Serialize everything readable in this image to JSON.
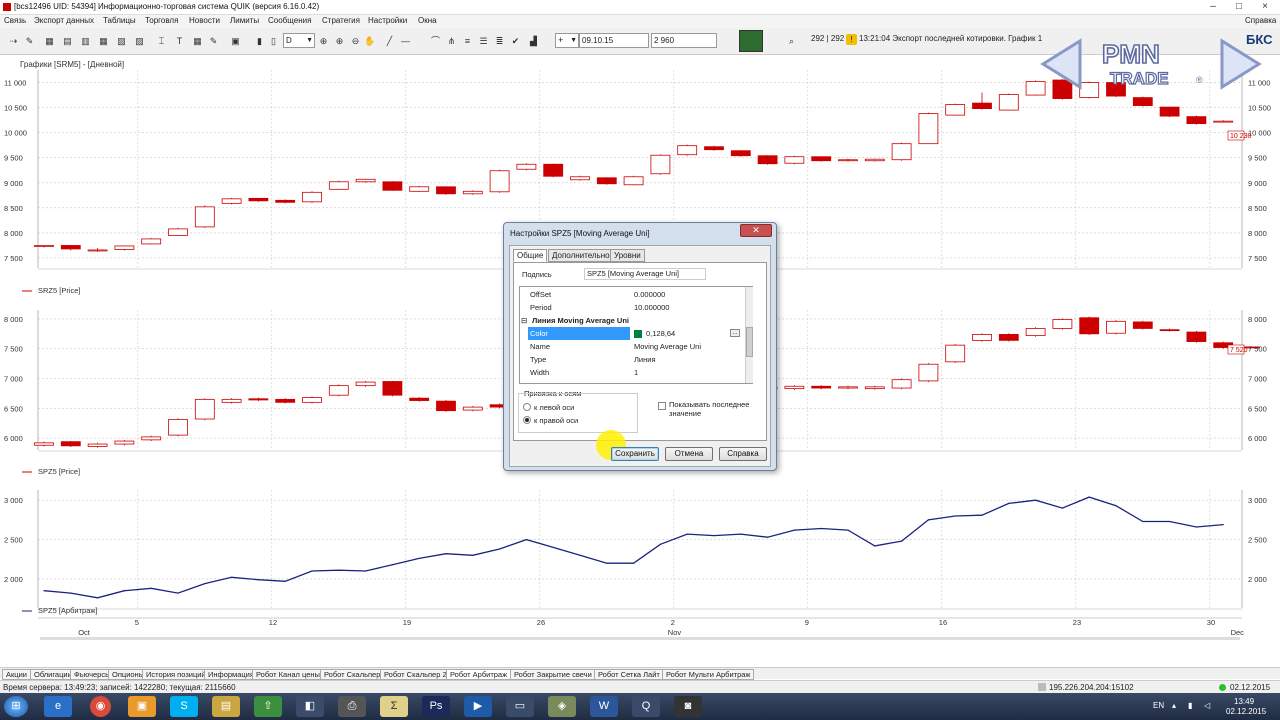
{
  "window": {
    "title": "[bcs12496 UID: 54394] Информационно-торговая система QUIK (версия 6.16.0.42)",
    "controls": [
      "–",
      "□",
      "×"
    ]
  },
  "menu": {
    "items": [
      "Связь",
      "Экспорт данных",
      "Таблицы",
      "Торговля",
      "Новости",
      "Лимиты",
      "Сообщения",
      "Стратегия",
      "Настройки",
      "Окна"
    ],
    "help": "Справка"
  },
  "toolbar": {
    "period": "D",
    "date_field": "09.10.15",
    "price_field": "2 960",
    "trade_counter": "292 | 292",
    "alert_text": "13:21:04  Экспорт последней котировки. График 1 М1 недосту",
    "broker_tag": "БКС"
  },
  "logo": {
    "line1": "PMN",
    "line2": "TRADE",
    "registered": "®"
  },
  "chart": {
    "window_title": "Графики [SRM5] - [Дневной]",
    "panel1_label": "SRZ5 [Price]",
    "panel2_label": "SPZ5 [Price]",
    "panel3_label": "SPZ5 [Арбитраж]",
    "panel1_last": "10 230",
    "panel2_last": "7 520"
  },
  "chart_data": [
    {
      "type": "candlestick",
      "series": [
        {
          "name": "SRZ5 [Price]"
        }
      ],
      "y_ticks": [
        7500,
        8000,
        8500,
        9000,
        9500,
        10000,
        10500,
        11000
      ],
      "y_tick_labels": [
        "7 500",
        "8 000",
        "8 500",
        "9 000",
        "9 500",
        "10 000",
        "10 500",
        "11 000"
      ],
      "ylim": [
        7300,
        11250
      ],
      "last_value": 10230,
      "candles": [
        [
          7730,
          7750,
          7710,
          7760
        ],
        [
          7750,
          7680,
          7650,
          7760
        ],
        [
          7640,
          7660,
          7620,
          7700
        ],
        [
          7670,
          7740,
          7650,
          7750
        ],
        [
          7780,
          7880,
          7770,
          7900
        ],
        [
          7950,
          8080,
          7940,
          8100
        ],
        [
          8120,
          8520,
          8100,
          8550
        ],
        [
          8590,
          8680,
          8570,
          8700
        ],
        [
          8690,
          8640,
          8620,
          8700
        ],
        [
          8650,
          8610,
          8590,
          8670
        ],
        [
          8620,
          8810,
          8600,
          8830
        ],
        [
          8870,
          9020,
          8860,
          9040
        ],
        [
          9020,
          9070,
          9000,
          9080
        ],
        [
          9020,
          8850,
          8840,
          9030
        ],
        [
          8830,
          8920,
          8820,
          8940
        ],
        [
          8920,
          8780,
          8760,
          8930
        ],
        [
          8780,
          8830,
          8760,
          8850
        ],
        [
          8820,
          9240,
          8800,
          9260
        ],
        [
          9270,
          9370,
          9250,
          9390
        ],
        [
          9370,
          9130,
          9110,
          9380
        ],
        [
          9060,
          9120,
          9040,
          9140
        ],
        [
          9100,
          8980,
          8960,
          9110
        ],
        [
          8960,
          9120,
          8950,
          9140
        ],
        [
          9180,
          9550,
          9160,
          9570
        ],
        [
          9560,
          9740,
          9540,
          9760
        ],
        [
          9720,
          9660,
          9640,
          9740
        ],
        [
          9640,
          9540,
          9520,
          9650
        ],
        [
          9540,
          9380,
          9360,
          9550
        ],
        [
          9390,
          9520,
          9370,
          9540
        ],
        [
          9520,
          9440,
          9420,
          9530
        ],
        [
          9440,
          9460,
          9420,
          9480
        ],
        [
          9440,
          9470,
          9420,
          9480
        ],
        [
          9460,
          9780,
          9440,
          9800
        ],
        [
          9780,
          10380,
          9770,
          10400
        ],
        [
          10350,
          10560,
          10340,
          10580
        ],
        [
          10590,
          10480,
          10460,
          10800
        ],
        [
          10450,
          10760,
          10440,
          10780
        ],
        [
          10750,
          11020,
          10740,
          11040
        ],
        [
          11050,
          10680,
          10660,
          11070
        ],
        [
          10700,
          11000,
          10680,
          11020
        ],
        [
          11000,
          10730,
          10710,
          11020
        ],
        [
          10700,
          10540,
          10520,
          10720
        ],
        [
          10510,
          10330,
          10310,
          10520
        ],
        [
          10320,
          10180,
          10160,
          10340
        ],
        [
          10210,
          10230,
          10200,
          10250
        ]
      ]
    },
    {
      "type": "candlestick",
      "series": [
        {
          "name": "SPZ5 [Price]"
        }
      ],
      "y_ticks": [
        6000,
        6500,
        7000,
        7500,
        8000
      ],
      "y_tick_labels": [
        "6 000",
        "6 500",
        "7 000",
        "7 500",
        "8 000"
      ],
      "ylim": [
        5800,
        8150
      ],
      "last_value": 7520,
      "candles": [
        [
          5880,
          5920,
          5860,
          5940
        ],
        [
          5940,
          5870,
          5850,
          5950
        ],
        [
          5860,
          5900,
          5840,
          5920
        ],
        [
          5900,
          5950,
          5880,
          5970
        ],
        [
          5970,
          6020,
          5950,
          6040
        ],
        [
          6050,
          6310,
          6030,
          6330
        ],
        [
          6320,
          6650,
          6300,
          6670
        ],
        [
          6600,
          6650,
          6580,
          6670
        ],
        [
          6660,
          6640,
          6620,
          6680
        ],
        [
          6650,
          6600,
          6580,
          6670
        ],
        [
          6600,
          6680,
          6580,
          6700
        ],
        [
          6720,
          6880,
          6700,
          6900
        ],
        [
          6880,
          6940,
          6860,
          6960
        ],
        [
          6950,
          6720,
          6700,
          6960
        ],
        [
          6670,
          6630,
          6610,
          6690
        ],
        [
          6620,
          6460,
          6440,
          6640
        ],
        [
          6470,
          6520,
          6450,
          6540
        ],
        [
          6560,
          6520,
          6500,
          6580
        ],
        [
          6580,
          6640,
          6560,
          6660
        ],
        [
          6640,
          6620,
          6600,
          6660
        ],
        [
          6620,
          6640,
          6600,
          6660
        ],
        [
          6640,
          6600,
          6580,
          6660
        ],
        [
          6600,
          6660,
          6580,
          6680
        ],
        [
          6660,
          6800,
          6640,
          6820
        ],
        [
          6800,
          6860,
          6780,
          6880
        ],
        [
          6860,
          6830,
          6810,
          6880
        ],
        [
          6830,
          6850,
          6810,
          6880
        ],
        [
          6850,
          6830,
          6810,
          6870
        ],
        [
          6830,
          6870,
          6810,
          6890
        ],
        [
          6870,
          6840,
          6820,
          6890
        ],
        [
          6840,
          6860,
          6820,
          6880
        ],
        [
          6830,
          6860,
          6810,
          6880
        ],
        [
          6840,
          6980,
          6820,
          7000
        ],
        [
          6960,
          7240,
          6940,
          7260
        ],
        [
          7280,
          7560,
          7260,
          7580
        ],
        [
          7640,
          7740,
          7620,
          7760
        ],
        [
          7740,
          7640,
          7620,
          7760
        ],
        [
          7720,
          7840,
          7700,
          7860
        ],
        [
          7840,
          7990,
          7820,
          8010
        ],
        [
          8020,
          7750,
          7730,
          8040
        ],
        [
          7760,
          7960,
          7740,
          7980
        ],
        [
          7950,
          7840,
          7820,
          7970
        ],
        [
          7820,
          7810,
          7790,
          7840
        ],
        [
          7780,
          7620,
          7600,
          7800
        ],
        [
          7600,
          7520,
          7500,
          7620
        ],
        [
          7530,
          7520,
          7500,
          7540
        ]
      ]
    },
    {
      "type": "line",
      "series": [
        {
          "name": "SPZ5 [Арбитраж]"
        }
      ],
      "y_ticks": [
        2000,
        2500,
        3000
      ],
      "y_tick_labels": [
        "2 000",
        "2 500",
        "3 000"
      ],
      "ylim": [
        1630,
        3130
      ],
      "values": [
        1850,
        1820,
        1760,
        1850,
        1880,
        1820,
        1940,
        2020,
        1990,
        1970,
        2100,
        2110,
        2100,
        2180,
        2260,
        2320,
        2300,
        2380,
        2500,
        2400,
        2300,
        2200,
        2200,
        2440,
        2570,
        2550,
        2570,
        2530,
        2620,
        2640,
        2620,
        2420,
        2480,
        2750,
        2800,
        2810,
        2960,
        3000,
        2900,
        3040,
        2930,
        2730,
        2730,
        2660,
        2690
      ]
    }
  ],
  "x_axis": {
    "labels": [
      {
        "label": "5",
        "idx": 3.5
      },
      {
        "label": "12",
        "idx": 8.5
      },
      {
        "label": "19",
        "idx": 13.5
      },
      {
        "label": "26",
        "idx": 18.5
      },
      {
        "label": "2",
        "idx": 23.5
      },
      {
        "label": "9",
        "idx": 28.5
      },
      {
        "label": "16",
        "idx": 33.5
      },
      {
        "label": "23",
        "idx": 38.5
      },
      {
        "label": "30",
        "idx": 43.5
      }
    ],
    "months": [
      {
        "label": "Oct",
        "idx": 1.5
      },
      {
        "label": "Nov",
        "idx": 23.5
      },
      {
        "label": "Dec",
        "idx": 44.5
      }
    ]
  },
  "dialog": {
    "title": "Настройки SPZ5 [Moving Average Uni]",
    "tabs": [
      "Общие",
      "Дополнительно",
      "Уровни"
    ],
    "caption_label": "Подпись",
    "caption_value": "SPZ5 [Moving Average Uni]",
    "properties": [
      {
        "name": "OffSet",
        "value": "0.000000"
      },
      {
        "name": "Period",
        "value": "10.000000"
      }
    ],
    "group_title": "Линия Moving Average Uni",
    "line_properties": [
      {
        "name": "Color",
        "value": "0,128,64",
        "selected": true
      },
      {
        "name": "Name",
        "value": "Moving Average Uni"
      },
      {
        "name": "Type",
        "value": "Линия"
      },
      {
        "name": "Width",
        "value": "1"
      }
    ],
    "axis_group_label": "Привязка к осям",
    "radio_left": "к левой оси",
    "radio_right": "к правой оси",
    "checkbox_label_1": "Показывать последнее",
    "checkbox_label_2": "значение",
    "buttons": {
      "save": "Сохранить",
      "cancel": "Отмена",
      "help": "Справка"
    },
    "color_swatch": "#008040"
  },
  "bottom_tabs": [
    "Акции",
    "Облигации",
    "Фьючерсы",
    "Опционы",
    "История позиций",
    "Информация",
    "Робот Канал цены",
    "Робот Скальпер",
    "Робот Скальпер 2",
    "Робот Арбитраж",
    "Робот Закрытие свечи",
    "Робот Сетка Лайт",
    "Робот Мульти Арбитраж"
  ],
  "active_bottom_tab": "Робот Арбитраж",
  "status": {
    "server": "Время сервера: 13:49:23; записей: 1422280; текущая: 2115660",
    "ip": "195.226.204.204:15102",
    "date": "02.12.2015"
  },
  "taskbar": {
    "lang": "EN",
    "time": "13:49",
    "date": "02.12.2015"
  },
  "colors": {
    "bear": "#cc0000",
    "bull_border": "#cc0000",
    "line": "#1a237e",
    "grid": "#c8c8c8"
  }
}
